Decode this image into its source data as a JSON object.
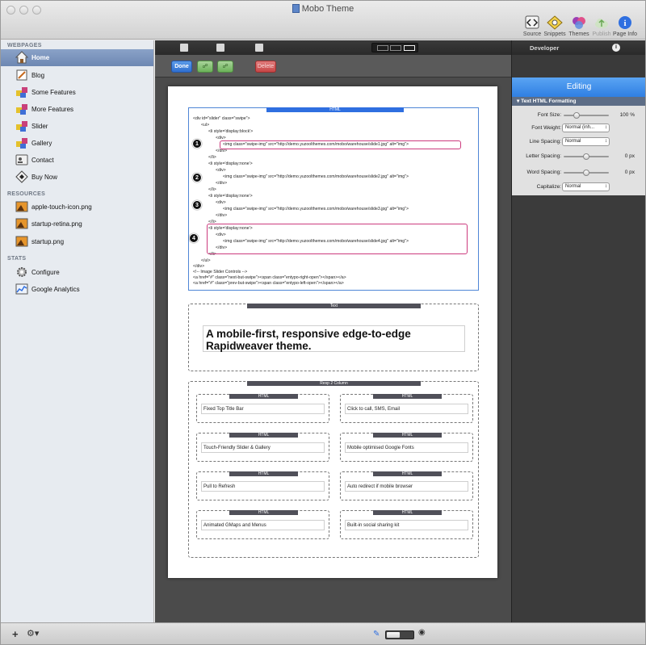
{
  "window": {
    "title": "Mobo Theme"
  },
  "toolbar": {
    "source": "Source",
    "snippets": "Snippets",
    "themes": "Themes",
    "publish": "Publish",
    "page_info": "Page Info"
  },
  "sidebar": {
    "webpages_header": "WEBPAGES",
    "webpages": [
      {
        "label": "Home",
        "icon": "home-icon"
      },
      {
        "label": "Blog",
        "icon": "blog-icon"
      },
      {
        "label": "Some Features",
        "icon": "blocks-icon"
      },
      {
        "label": "More Features",
        "icon": "blocks-icon"
      },
      {
        "label": "Slider",
        "icon": "blocks-icon"
      },
      {
        "label": "Gallery",
        "icon": "blocks-icon"
      },
      {
        "label": "Contact",
        "icon": "contact-icon"
      },
      {
        "label": "Buy Now",
        "icon": "buy-icon"
      }
    ],
    "resources_header": "RESOURCES",
    "resources": [
      {
        "label": "apple-touch-icon.png"
      },
      {
        "label": "startup-retina.png"
      },
      {
        "label": "startup.png"
      }
    ],
    "stats_header": "STATS",
    "stats": [
      {
        "label": "Configure"
      },
      {
        "label": "Google Analytics"
      }
    ]
  },
  "editor": {
    "done_label": "Done",
    "delete_label": "Delete",
    "html_tab": "HTML",
    "code_lines": [
      "<div id=\"slider\" class=\"swipe\">",
      "<ul>",
      "<li style='display:block'>",
      "<div>",
      "<img class=\"swipe-img\" src=\"http://demo.yuzoolthemes.com/mobo/warehouse/slide1.jpg\" alt=\"img\">",
      "</div>",
      "</li>",
      "<li style='display:none'>",
      "<div>",
      "<img class=\"swipe-img\" src=\"http://demo.yuzoolthemes.com/mobo/warehouse/slide2.jpg\" alt=\"img\">",
      "</div>",
      "</li>",
      "<li style='display:none'>",
      "<div>",
      "<img class=\"swipe-img\" src=\"http://demo.yuzoolthemes.com/mobo/warehouse/slide3.jpg\" alt=\"img\">",
      "</div>",
      "</li>",
      "<li style='display:none'>",
      "<div>",
      "<img class=\"swipe-img\" src=\"http://demo.yuzoolthemes.com/mobo/warehouse/slide4.jpg\" alt=\"img\">",
      "</div>",
      "</li>",
      "</ul>",
      "</div>",
      "<!-- Image Slider Controls -->",
      "<a href=\"#\" class=\"next-but-swipe\"><span class=\"entypo-right-open\"></span></a>",
      "<a href=\"#\" class=\"prev-but-swipe\"><span class=\"entypo-left-open\"></span></a>"
    ],
    "callouts": [
      "1",
      "2",
      "3",
      "4"
    ],
    "text_tab": "Text",
    "headline": "A mobile-first, responsive edge-to-edge Rapidweaver theme.",
    "resp_tab": "Resp 2 Column",
    "columns": [
      {
        "tab": "HTML",
        "text": "Fixed Top Title Bar"
      },
      {
        "tab": "HTML",
        "text": "Click to call, SMS, Email"
      },
      {
        "tab": "HTML",
        "text": "Touch-Friendly Slider & Gallery"
      },
      {
        "tab": "HTML",
        "text": "Mobile optimised Google Fonts"
      },
      {
        "tab": "HTML",
        "text": "Pull to Refresh"
      },
      {
        "tab": "HTML",
        "text": "Auto redirect if mobile browser"
      },
      {
        "tab": "HTML",
        "text": "Animated GMaps and Menus"
      },
      {
        "tab": "HTML",
        "text": "Built-in social sharing kit"
      }
    ]
  },
  "inspector": {
    "developer": "Developer",
    "info": "i",
    "editing": "Editing",
    "section": "Text HTML Formatting",
    "font_size_label": "Font Size:",
    "font_size_value": "100 %",
    "font_size_level": 0.25,
    "font_weight_label": "Font Weight:",
    "font_weight_value": "Normal (inh...",
    "line_spacing_label": "Line Spacing:",
    "line_spacing_value": "Normal",
    "letter_spacing_label": "Letter Spacing:",
    "letter_spacing_value": "0 px",
    "letter_spacing_level": 0.5,
    "word_spacing_label": "Word Spacing:",
    "word_spacing_value": "0 px",
    "word_spacing_level": 0.5,
    "capitalize_label": "Capitalize:",
    "capitalize_value": "Normal"
  },
  "colors": {
    "accent": "#2f7fe3",
    "highlight": "#cc3b7e",
    "selected_row": "#7990ba"
  }
}
